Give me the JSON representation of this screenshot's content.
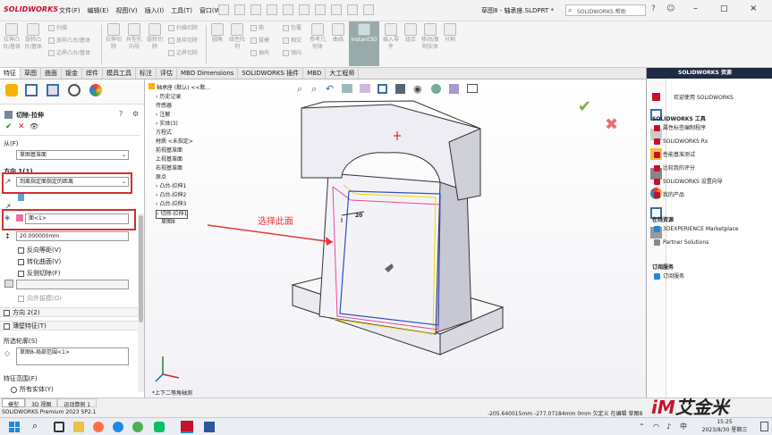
{
  "titlebar": {
    "logo": "SOLIDWORKS",
    "menus": [
      "文件(F)",
      "编辑(E)",
      "视图(V)",
      "插入(I)",
      "工具(T)",
      "窗口(W)"
    ],
    "doc_title": "草图8 - 轴承座.SLDPRT *",
    "search_placeholder": "SOLIDWORKS 帮助"
  },
  "ribbon": {
    "buttons": [
      "拉伸凸台/基体",
      "旋转凸台/基体",
      "扫描",
      "放样凸台/基体",
      "边界凸台/基体",
      "拉伸切除",
      "异型孔向导",
      "旋转切除",
      "扫描切除",
      "放样切除",
      "边界切除",
      "圆角",
      "线性阵列",
      "筋",
      "拔模",
      "抽壳",
      "包覆",
      "相交",
      "镜向",
      "参考几何体",
      "曲线",
      "Instant3D",
      "插入零件",
      "组合",
      "移动/复制实体",
      "分割"
    ]
  },
  "cmdtabs": [
    "特征",
    "草图",
    "曲面",
    "钣金",
    "焊件",
    "模具工具",
    "标注",
    "评估",
    "MBD Dimensions",
    "SOLIDWORKS 插件",
    "MBD",
    "大工程师"
  ],
  "pm": {
    "title": "切除-拉伸",
    "from_label": "从(F)",
    "from_value": "草图基准面",
    "dir1_label": "方向 1(1)",
    "dir1_type": "到离指定面指定的距离",
    "face_value": "面<1>",
    "distance": "20.000000mm",
    "opt_reverse_offset": "反向等距(V)",
    "opt_transform": "转化曲面(V)",
    "opt_flip": "反侧切除(F)",
    "opt_draft": "向外拔模(O)",
    "dir2_label": "方向 2(2)",
    "thin_label": "薄壁特征(T)",
    "contours_label": "所选轮廓(S)",
    "contour_value": "草图8-局部范围<1>",
    "scope_label": "特征范围(F)",
    "scope_all": "所有实体(Y)"
  },
  "tree": {
    "root": "轴承座 (默认) <<默...",
    "items": [
      "历史记录",
      "传感器",
      "注解",
      "实体(3)",
      "方程式",
      "材质 <未指定>",
      "前视基准面",
      "上视基准面",
      "右视基准面",
      "原点",
      "凸台-拉伸1",
      "凸台-拉伸2",
      "凸台-拉伸3",
      "切除-拉伸1",
      "草图8"
    ]
  },
  "viewport": {
    "dim_label": "20",
    "callout": "选择此面",
    "view_name": "*上下二等角轴测"
  },
  "taskpane": {
    "header": "SOLIDWORKS 资源",
    "welcome": "欢迎使用 SOLIDWORKS",
    "tools_title": "SOLIDWORKS 工具",
    "tools": [
      "属性标签编制程序",
      "SOLIDWORKS Rx",
      "性能基准测试",
      "比较我的评分",
      "SOLIDWORKS 设置向导",
      "我的产品"
    ],
    "online_title": "在线资源",
    "online": [
      "3DEXPERIENCE Marketplace",
      "Partner Solutions"
    ],
    "sub_title": "订阅服务",
    "sub": [
      "订阅服务"
    ]
  },
  "statusbar": {
    "tabs": [
      "模型",
      "3D 视图",
      "运动算例 1"
    ],
    "version": "SOLIDWORKS Premium 2023 SP2.1",
    "coords": "-205.640015mm   -277.07184mm   0mm 欠定义   在编辑 草图8",
    "watermark": "艾金米"
  },
  "taskbar": {
    "time": "15:25",
    "date": "2023/8/30 星期三",
    "ime": "中"
  },
  "colors": {
    "accent": "#c8102e",
    "callout": "#e53935",
    "annot_box": "#d32f2f"
  }
}
